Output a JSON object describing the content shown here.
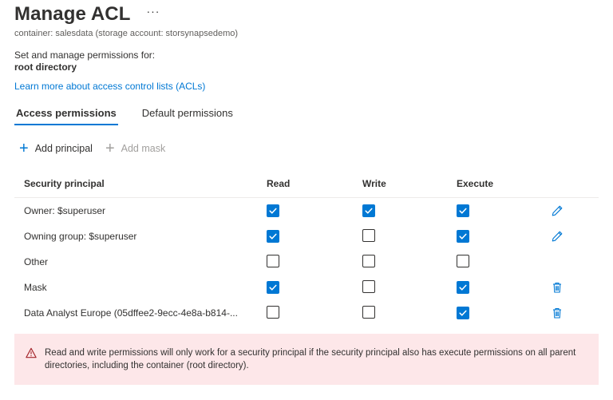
{
  "header": {
    "title": "Manage ACL",
    "more_label": "···",
    "subtitle": "container: salesdata (storage account: storsynapsedemo)",
    "set_text": "Set and manage permissions for:",
    "target": "root directory",
    "learn_more": "Learn more about access control lists (ACLs)"
  },
  "tabs": [
    {
      "label": "Access permissions",
      "active": true
    },
    {
      "label": "Default permissions",
      "active": false
    }
  ],
  "commands": {
    "add_principal": "Add principal",
    "add_mask": "Add mask"
  },
  "table": {
    "columns": [
      "Security principal",
      "Read",
      "Write",
      "Execute"
    ],
    "rows": [
      {
        "principal": "Owner: $superuser",
        "read": true,
        "write": true,
        "execute": true,
        "action": "edit-icon"
      },
      {
        "principal": "Owning group: $superuser",
        "read": true,
        "write": false,
        "execute": true,
        "action": "edit-icon"
      },
      {
        "principal": "Other",
        "read": false,
        "write": false,
        "execute": false,
        "action": ""
      },
      {
        "principal": "Mask",
        "read": true,
        "write": false,
        "execute": true,
        "action": "delete-icon"
      },
      {
        "principal": "Data Analyst Europe (05dffee2-9ecc-4e8a-b814-...",
        "read": false,
        "write": false,
        "execute": true,
        "action": "delete-icon"
      }
    ]
  },
  "warning": {
    "text": "Read and write permissions will only work for a security principal if the security principal also has execute permissions on all parent directories, including the container (root directory)."
  },
  "colors": {
    "accent": "#0078d4",
    "warning_bg": "#fde7e9",
    "warning_icon": "#a4262c",
    "text": "#323130",
    "muted": "#605e5c",
    "disabled": "#a19f9d"
  }
}
